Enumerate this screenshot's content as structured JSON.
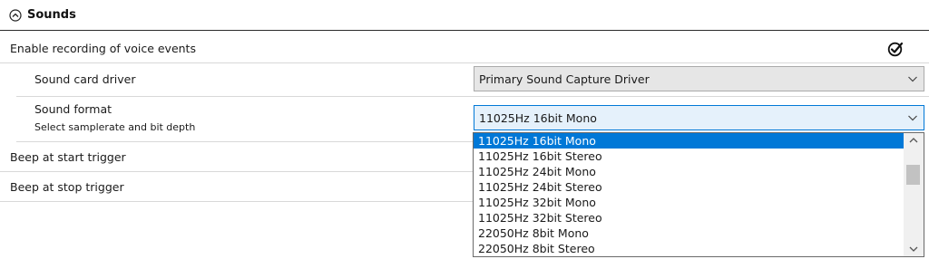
{
  "section": {
    "title": "Sounds",
    "collapse_icon": "chevron-up-circle-icon"
  },
  "settings": {
    "enable_recording": {
      "label": "Enable recording of voice events",
      "checked": true,
      "icon": "check-circle-icon"
    },
    "sound_card_driver": {
      "label": "Sound card driver",
      "value": "Primary Sound Capture Driver"
    },
    "sound_format": {
      "label": "Sound format",
      "description": "Select samplerate and bit depth",
      "value": "11025Hz 16bit Mono",
      "options": [
        "11025Hz 16bit Mono",
        "11025Hz 16bit Stereo",
        "11025Hz 24bit Mono",
        "11025Hz 24bit Stereo",
        "11025Hz 32bit Mono",
        "11025Hz 32bit Stereo",
        "22050Hz 8bit Mono",
        "22050Hz 8bit Stereo"
      ],
      "selected_index": 0
    },
    "beep_start": {
      "label": "Beep at start trigger"
    },
    "beep_stop": {
      "label": "Beep at stop trigger"
    }
  },
  "colors": {
    "accent": "#0078d7",
    "selection_text": "#ffffff",
    "combo_bg": "#e6e6e6",
    "combo_open_bg": "#e5f1fb"
  }
}
